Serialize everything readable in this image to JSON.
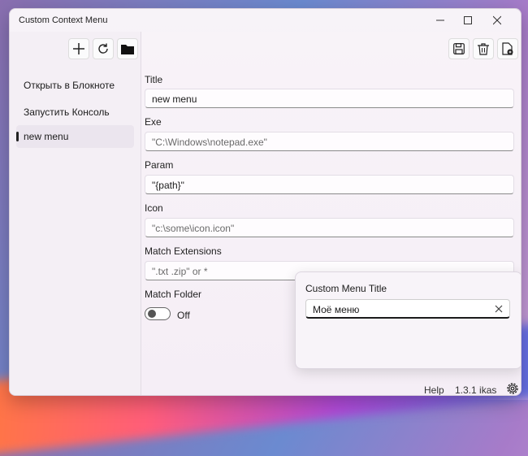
{
  "window": {
    "title": "Custom Context Menu"
  },
  "sidebar": {
    "items": [
      {
        "label": "Открыть в Блокноте"
      },
      {
        "label": "Запустить Консоль"
      },
      {
        "label": "new menu"
      }
    ]
  },
  "form": {
    "title": {
      "label": "Title",
      "value": "new menu"
    },
    "exe": {
      "label": "Exe",
      "placeholder": "\"C:\\Windows\\notepad.exe\""
    },
    "param": {
      "label": "Param",
      "value": "\"{path}\""
    },
    "icon": {
      "label": "Icon",
      "placeholder": "\"c:\\some\\icon.icon\""
    },
    "match_extensions": {
      "label": "Match Extensions",
      "placeholder": "\".txt .zip\" or *"
    },
    "match_folder": {
      "label": "Match Folder",
      "toggle_text": "Off"
    }
  },
  "popup": {
    "title": "Custom Menu Title",
    "value": "Моё меню"
  },
  "status": {
    "help": "Help",
    "version": "1.3.1 ikas"
  },
  "icons": {
    "add": "plus-icon",
    "refresh": "refresh-icon",
    "open_folder": "folder-icon",
    "save": "save-icon",
    "delete": "trash-icon",
    "export": "export-file-icon",
    "settings": "gear-icon",
    "clear": "close-icon"
  }
}
